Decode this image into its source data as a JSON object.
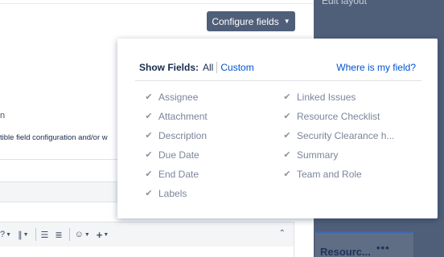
{
  "background": {
    "edit_layout_label": "Edit layout",
    "resource_panel_title": "Resourc...",
    "resource_panel_more": "•••"
  },
  "dialog": {
    "configure_button_label": "Configure fields",
    "stray_text": "n",
    "compat_text": "tible field configuration and/or w",
    "toolbar": {
      "text_style_icon": "?",
      "attachment_icon": "∥",
      "bullet_list_icon": "☰",
      "numbered_list_icon": "≣",
      "emoji_icon": "☺",
      "insert_icon": "+",
      "collapse_icon": "⌃"
    }
  },
  "popup": {
    "show_fields_label": "Show Fields:",
    "all_option": "All",
    "custom_option": "Custom",
    "where_link": "Where is my field?",
    "left_fields": [
      {
        "label": "Assignee",
        "checked": true
      },
      {
        "label": "Attachment",
        "checked": true
      },
      {
        "label": "Description",
        "checked": true
      },
      {
        "label": "Due Date",
        "checked": true
      },
      {
        "label": "End Date",
        "checked": true
      },
      {
        "label": "Labels",
        "checked": true
      }
    ],
    "right_fields": [
      {
        "label": "Linked Issues",
        "checked": true
      },
      {
        "label": "Resource Checklist",
        "checked": true
      },
      {
        "label": "Security Clearance h...",
        "checked": true
      },
      {
        "label": "Summary",
        "checked": true
      },
      {
        "label": "Team and Role",
        "checked": true
      }
    ]
  },
  "colors": {
    "overlay": "#505f79",
    "button_bg": "#505f79",
    "link": "#0052cc",
    "disabled_text": "#7a869a"
  }
}
